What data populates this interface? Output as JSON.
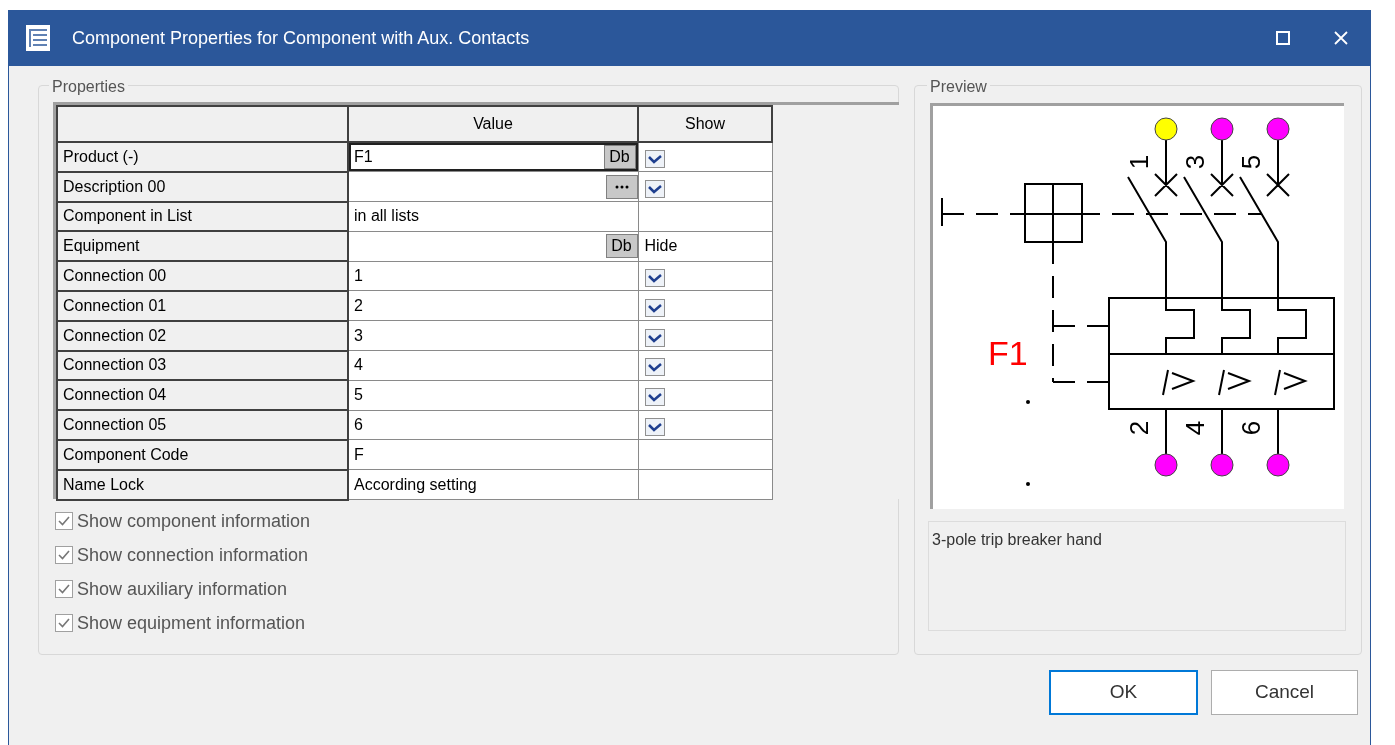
{
  "window": {
    "title": "Component Properties for Component with Aux. Contacts"
  },
  "properties": {
    "title": "Properties",
    "columns": [
      "Value",
      "Show"
    ],
    "rows": [
      {
        "name": "Product (-)",
        "value": "F1",
        "button": {
          "kind": "text",
          "text": "Db"
        },
        "show": {
          "kind": "checkbox",
          "checked": true
        },
        "selected": true
      },
      {
        "name": "Description 00",
        "value": "",
        "button": {
          "kind": "ellipsis"
        },
        "show": {
          "kind": "checkbox",
          "checked": true
        },
        "selected": false
      },
      {
        "name": "Component in List",
        "value": "in all lists",
        "show": {
          "kind": "none"
        },
        "selected": false
      },
      {
        "name": "Equipment",
        "value": "",
        "button": {
          "kind": "text",
          "text": "Db"
        },
        "show": {
          "kind": "text",
          "text": "Hide"
        },
        "selected": false
      },
      {
        "name": "Connection 00",
        "value": "1",
        "show": {
          "kind": "checkbox",
          "checked": true
        },
        "selected": false
      },
      {
        "name": "Connection 01",
        "value": "2",
        "show": {
          "kind": "checkbox",
          "checked": true
        },
        "selected": false
      },
      {
        "name": "Connection 02",
        "value": "3",
        "show": {
          "kind": "checkbox",
          "checked": true
        },
        "selected": false
      },
      {
        "name": "Connection 03",
        "value": "4",
        "show": {
          "kind": "checkbox",
          "checked": true
        },
        "selected": false
      },
      {
        "name": "Connection 04",
        "value": "5",
        "show": {
          "kind": "checkbox",
          "checked": true
        },
        "selected": false
      },
      {
        "name": "Connection 05",
        "value": "6",
        "show": {
          "kind": "checkbox",
          "checked": true
        },
        "selected": false
      },
      {
        "name": "Component Code",
        "value": "F",
        "show": {
          "kind": "none"
        },
        "selected": false
      },
      {
        "name": "Name Lock",
        "value": "According setting",
        "show": {
          "kind": "none"
        },
        "selected": false
      }
    ],
    "options": [
      {
        "label": "Show component information",
        "checked": true
      },
      {
        "label": "Show connection information",
        "checked": true
      },
      {
        "label": "Show auxiliary information",
        "checked": true
      },
      {
        "label": "Show equipment information",
        "checked": true
      }
    ]
  },
  "preview": {
    "title": "Preview",
    "designation": "F1",
    "terminals_top": [
      {
        "label": "1",
        "color": "#ffff00"
      },
      {
        "label": "3",
        "color": "#ff00ff"
      },
      {
        "label": "5",
        "color": "#ff00ff"
      }
    ],
    "terminals_bottom": [
      {
        "label": "2",
        "color": "#ff00ff"
      },
      {
        "label": "4",
        "color": "#ff00ff"
      },
      {
        "label": "6",
        "color": "#ff00ff"
      }
    ],
    "description": "3-pole trip breaker hand"
  },
  "buttons": [
    {
      "label": "OK",
      "default": true
    },
    {
      "label": "Cancel",
      "default": false
    }
  ]
}
